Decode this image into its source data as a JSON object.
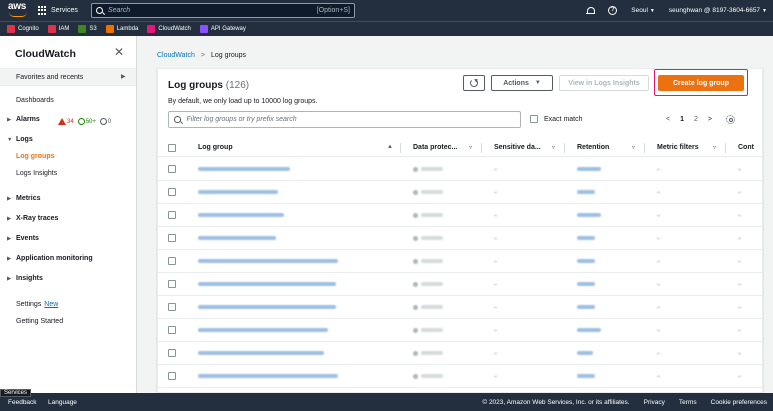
{
  "topnav": {
    "logo": "aws",
    "services_label": "Services",
    "search_placeholder": "Search",
    "search_shortcut": "[Option+S]",
    "region": "Seoul",
    "account": "seunghwan @ 8197-3604-6657"
  },
  "favorites": [
    {
      "label": "Cognito",
      "color": "#dd344c"
    },
    {
      "label": "IAM",
      "color": "#dd344c"
    },
    {
      "label": "S3",
      "color": "#3f8624"
    },
    {
      "label": "Lambda",
      "color": "#ed7100"
    },
    {
      "label": "CloudWatch",
      "color": "#e7157b"
    },
    {
      "label": "API Gateway",
      "color": "#8c4fff"
    }
  ],
  "sidenav": {
    "title": "CloudWatch",
    "favorites_label": "Favorites and recents",
    "dashboards": "Dashboards",
    "alarms": "Alarms",
    "alarm_in_alarm": "34",
    "alarm_ok": "50+",
    "alarm_insufficient": "0",
    "logs": "Logs",
    "log_groups": "Log groups",
    "logs_insights": "Logs Insights",
    "metrics": "Metrics",
    "xray": "X-Ray traces",
    "events": "Events",
    "app_monitoring": "Application monitoring",
    "insights": "Insights",
    "settings": "Settings",
    "settings_new": "New",
    "getting_started": "Getting Started"
  },
  "breadcrumb": {
    "root": "CloudWatch",
    "current": "Log groups"
  },
  "panel": {
    "title": "Log groups",
    "count": "(126)",
    "description": "By default, we only load up to 10000 log groups.",
    "actions_label": "Actions",
    "view_insights_label": "View in Logs Insights",
    "create_label": "Create log group",
    "filter_placeholder": "Filter log groups or try prefix search",
    "exact_match_label": "Exact match",
    "pages": [
      "1",
      "2"
    ]
  },
  "table": {
    "columns": [
      "Log group",
      "Data protec...",
      "Sensitive da...",
      "Retention",
      "Metric filters",
      "Cont"
    ],
    "rows": 11
  },
  "footer": {
    "feedback": "Feedback",
    "services_tip": "Services",
    "language": "Language",
    "copyright": "© 2023, Amazon Web Services, Inc. or its affiliates.",
    "privacy": "Privacy",
    "terms": "Terms",
    "cookies": "Cookie preferences"
  },
  "colors": {
    "accent": "#ec7211",
    "link": "#0073bb",
    "nav_bg": "#232f3e",
    "highlight": "#e7157b"
  }
}
